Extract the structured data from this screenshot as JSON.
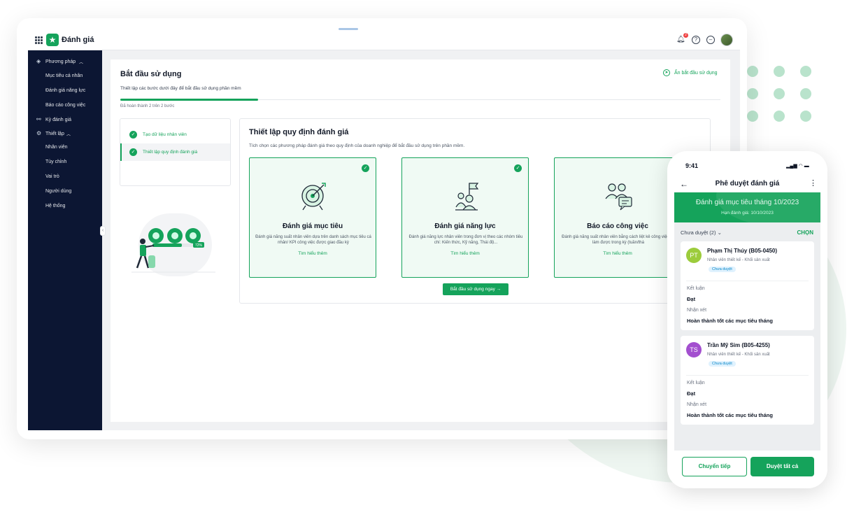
{
  "app": {
    "title": "Đánh giá",
    "notification_count": "2"
  },
  "sidebar": {
    "groups": [
      {
        "label": "Phương pháp",
        "icon": "layers-icon",
        "items": [
          "Mục tiêu cá nhân",
          "Đánh giá năng lực",
          "Báo cáo công việc"
        ]
      },
      {
        "label": "Kỳ đánh giá",
        "icon": "nodes-icon",
        "items": []
      },
      {
        "label": "Thiết lập",
        "icon": "gear-icon",
        "items": [
          "Nhân viên",
          "Tùy chỉnh",
          "Vai trò",
          "Người dùng",
          "Hệ thống"
        ]
      }
    ]
  },
  "onboarding": {
    "title": "Bắt đầu sử dụng",
    "subtitle": "Thiết lập các bước dưới đây để bắt đầu sử dụng phần mềm",
    "progress_percent": 23,
    "progress_text": "Đã hoàn thành 2 trên 2 bước",
    "hide_label": "Ẩn bắt đầu sử dụng",
    "steps": [
      "Tạo dữ liệu nhân viên",
      "Thiết lập quy định đánh giá"
    ],
    "panel_title": "Thiết lập quy định đánh giá",
    "panel_desc": "Tích chọn các phương pháp đánh giá theo quy định của doanh nghiệp để bắt đầu sử dụng trên phần mềm.",
    "cards": [
      {
        "title": "Đánh giá mục tiêu",
        "desc": "Đánh giá năng suất nhân viên dựa trên danh sách mục tiêu cá nhân/ KPI công việc được giao đầu kỳ",
        "link": "Tìm hiểu thêm",
        "icon": "target-icon"
      },
      {
        "title": "Đánh giá năng lực",
        "desc": "Đánh giá năng lực nhân viên trong đơn vị theo các nhóm tiêu chí: Kiến thức, Kỹ năng, Thái độ...",
        "link": "Tìm hiểu thêm",
        "icon": "team-flag-icon"
      },
      {
        "title": "Báo cáo công việc",
        "desc": "Đánh giá năng suất nhân viên bằng cách liệt kê công việc đã làm được trong kỳ (tuần/thá",
        "link": "Tìm hiểu thêm",
        "icon": "users-chat-icon"
      }
    ],
    "cta": "Bắt đầu sử dụng ngay →",
    "illustration_progress": "72%"
  },
  "phone": {
    "time": "9:41",
    "title": "Phê duyệt đánh giá",
    "banner_title": "Đánh giá mục tiêu tháng 10/2023",
    "banner_deadline": "Hạn đánh giá: 10/10/2023",
    "filter": "Chưa duyệt (2)",
    "choose": "CHỌN",
    "reviews": [
      {
        "initials": "PT",
        "name": "Phạm Thị Thúy (B05-0450)",
        "role": "Nhân viên thiết kế - Khối sản xuất",
        "status": "Chưa duyệt",
        "result_label": "Kết luận",
        "result": "Đạt",
        "comment_label": "Nhận xét",
        "comment": "Hoàn thành tốt các mục tiêu tháng",
        "color": "#9ccc3c"
      },
      {
        "initials": "TS",
        "name": "Trần Mỹ Sim (B05-4255)",
        "role": "Nhân viên thiết kế - Khối sản xuất",
        "status": "Chưa duyệt",
        "result_label": "Kết luận",
        "result": "Đạt",
        "comment_label": "Nhận xét",
        "comment": "Hoàn thành tốt các mục tiêu tháng",
        "color": "#a34fcf"
      }
    ],
    "forward": "Chuyển tiếp",
    "approve_all": "Duyệt tất cả"
  }
}
